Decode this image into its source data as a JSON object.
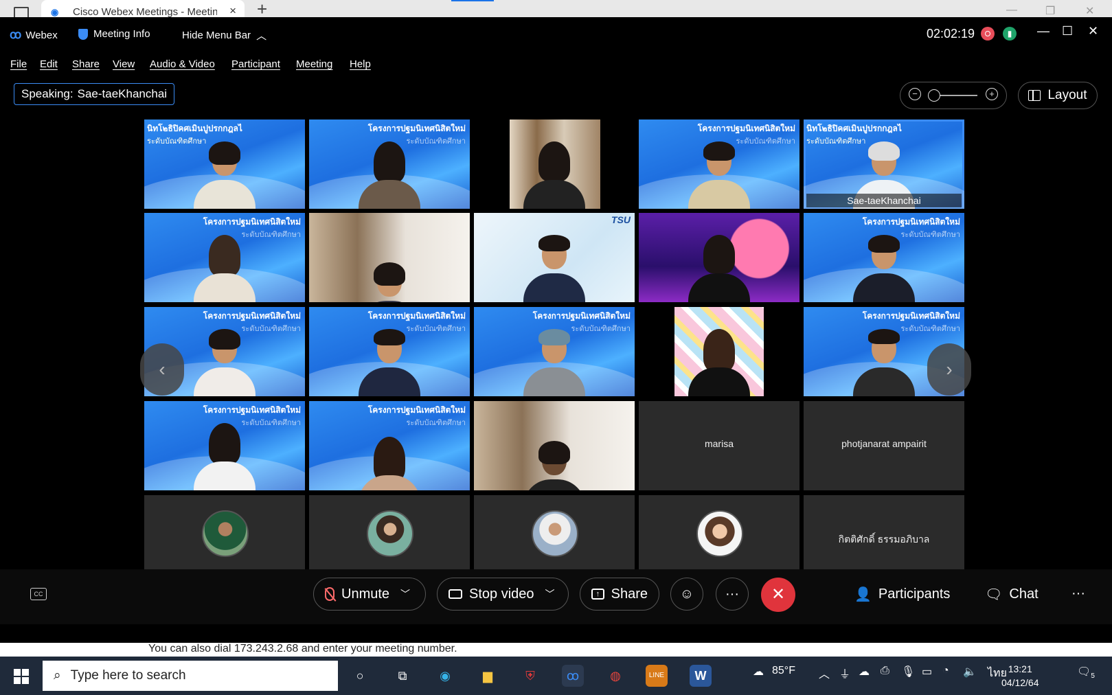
{
  "browser": {
    "tab_title": "Cisco Webex Meetings - Meeting",
    "tab_close": "×",
    "new_tab": "+"
  },
  "webex": {
    "app_name": "Webex",
    "meeting_info": "Meeting Info",
    "hide_menu_bar": "Hide Menu Bar",
    "timer": "02:02:19",
    "menu": [
      "File",
      "Edit",
      "Share",
      "View",
      "Audio & Video",
      "Participant",
      "Meeting",
      "Help"
    ],
    "speaking_label": "Speaking:",
    "speaking_name": "Sae-taeKhanchai",
    "layout_label": "Layout"
  },
  "grid": {
    "banner_thai": "โครงการปฐมนิเทศนิสิตใหม่",
    "banner_sub": "ระดับบัณฑิตศึกษา",
    "first_banner": "นิทโ๒ธิปิคศเมินปูปรกกฎลไ",
    "first_sub": "ระดับบัณฑิตศึกษา",
    "tsu_logo": "TSU",
    "active_name": "Sae-taeKhanchai",
    "names": {
      "marisa": "marisa",
      "photjanarat": "photjanarat ampairit",
      "kittisak": "กิตติศักดิ์ ธรรมอภิบาล"
    },
    "nav_prev": "‹",
    "nav_next": "›"
  },
  "toolbar": {
    "cc": "CC",
    "unmute": "Unmute",
    "stop_video": "Stop video",
    "share": "Share",
    "more": "···",
    "end": "✕",
    "participants": "Participants",
    "chat": "Chat",
    "overflow": "···"
  },
  "footer": {
    "dial_message": "You can also dial 173.243.2.68 and enter your meeting number."
  },
  "taskbar": {
    "search_placeholder": "Type here to search",
    "weather": "85°F",
    "language": "ไทย",
    "time": "13:21",
    "date": "04/12/64",
    "notification_count": "5"
  },
  "colors": {
    "accent": "#3b8cf5",
    "end_call": "#e0343c",
    "record": "#e84d5a",
    "network": "#1fa36a"
  }
}
